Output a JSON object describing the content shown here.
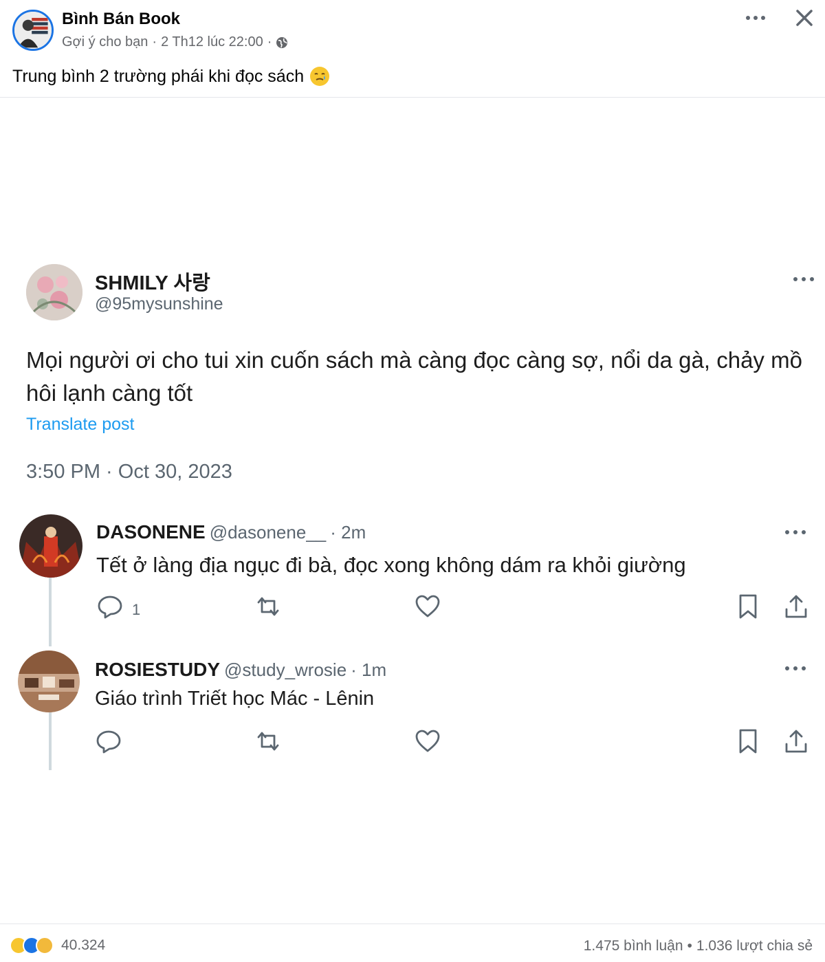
{
  "post": {
    "author": "Bình Bán Book",
    "suggested": "Gợi ý cho bạn",
    "separator": "·",
    "timestamp": "2 Th12 lúc 22:00",
    "caption": "Trung bình 2 trường phái khi đọc sách"
  },
  "tweet": {
    "name": "SHMILY 사랑",
    "handle": "@95mysunshine",
    "text": "Mọi người ơi cho tui xin cuốn sách mà càng đọc càng sợ, nổi da gà, chảy mồ hôi lạnh càng tốt",
    "translate": "Translate post",
    "time": "3:50 PM · Oct 30, 2023"
  },
  "replies": [
    {
      "name": "DASONENE",
      "handle": "@dasonene__",
      "age": "· 2m",
      "text": "Tết ở làng địa ngục đi bà, đọc xong không dám ra khỏi giường",
      "reply_count": "1"
    },
    {
      "name": "ROSIESTUDY",
      "handle": "@study_wrosie",
      "age": "· 1m",
      "text": "Giáo trình Triết học Mác - Lênin",
      "reply_count": ""
    }
  ],
  "footer": {
    "reaction_count": "40.324",
    "comments": "1.475 bình luận",
    "bullet": "•",
    "shares": "1.036 lượt chia sẻ"
  },
  "colors": {
    "link": "#1d9bf0",
    "fb_blue": "#1b74e4",
    "muted": "#65676b"
  },
  "icons": [
    "more-icon",
    "close-icon",
    "globe-icon",
    "reply-icon",
    "retweet-icon",
    "like-icon",
    "bookmark-icon",
    "share-icon"
  ]
}
